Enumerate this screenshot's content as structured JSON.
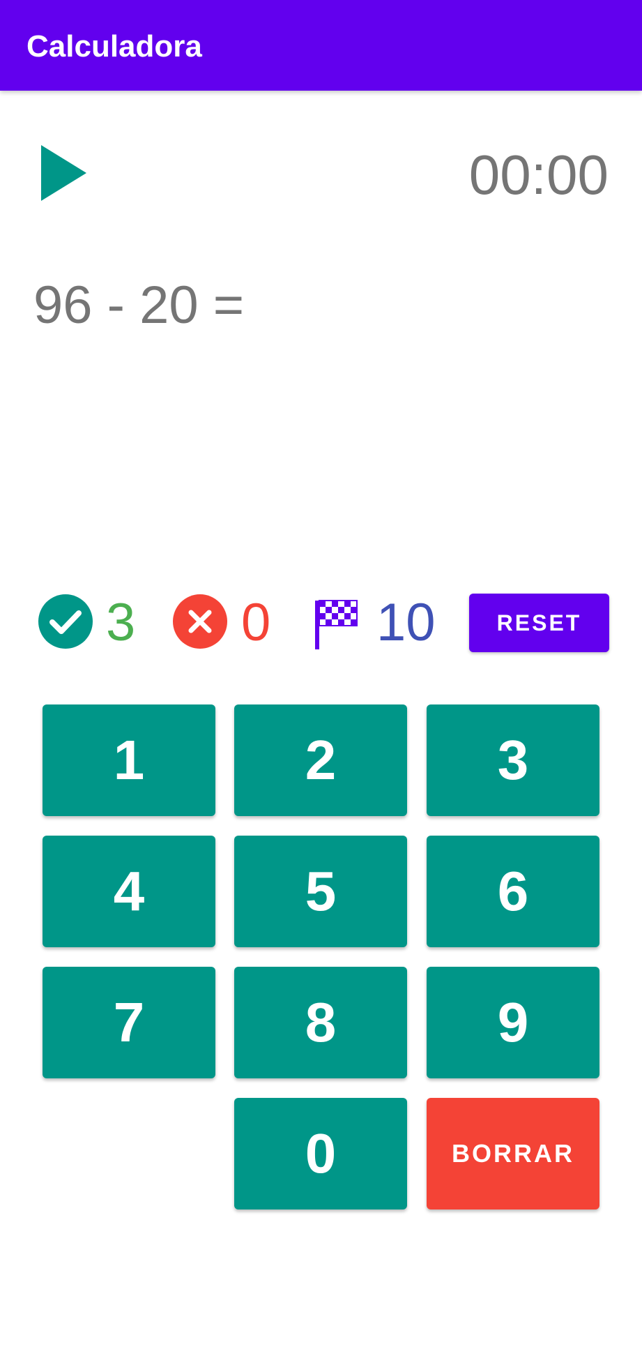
{
  "app": {
    "title": "Calculadora",
    "accent_color": "#6200EE",
    "primary_color": "#009688"
  },
  "controls": {
    "play_icon": "play-icon",
    "timer": "00:00"
  },
  "problem": {
    "expression": "96 - 20 ="
  },
  "stats": {
    "correct": {
      "icon": "check-circle-icon",
      "value": "3",
      "color": "#4CAF50"
    },
    "wrong": {
      "icon": "close-circle-icon",
      "value": "0",
      "color": "#F44336"
    },
    "goal": {
      "icon": "checkered-flag-icon",
      "value": "10",
      "color": "#3F51B5"
    },
    "reset_label": "RESET"
  },
  "keypad": {
    "keys": [
      "1",
      "2",
      "3",
      "4",
      "5",
      "6",
      "7",
      "8",
      "9",
      "0"
    ],
    "erase_label": "BORRAR"
  }
}
